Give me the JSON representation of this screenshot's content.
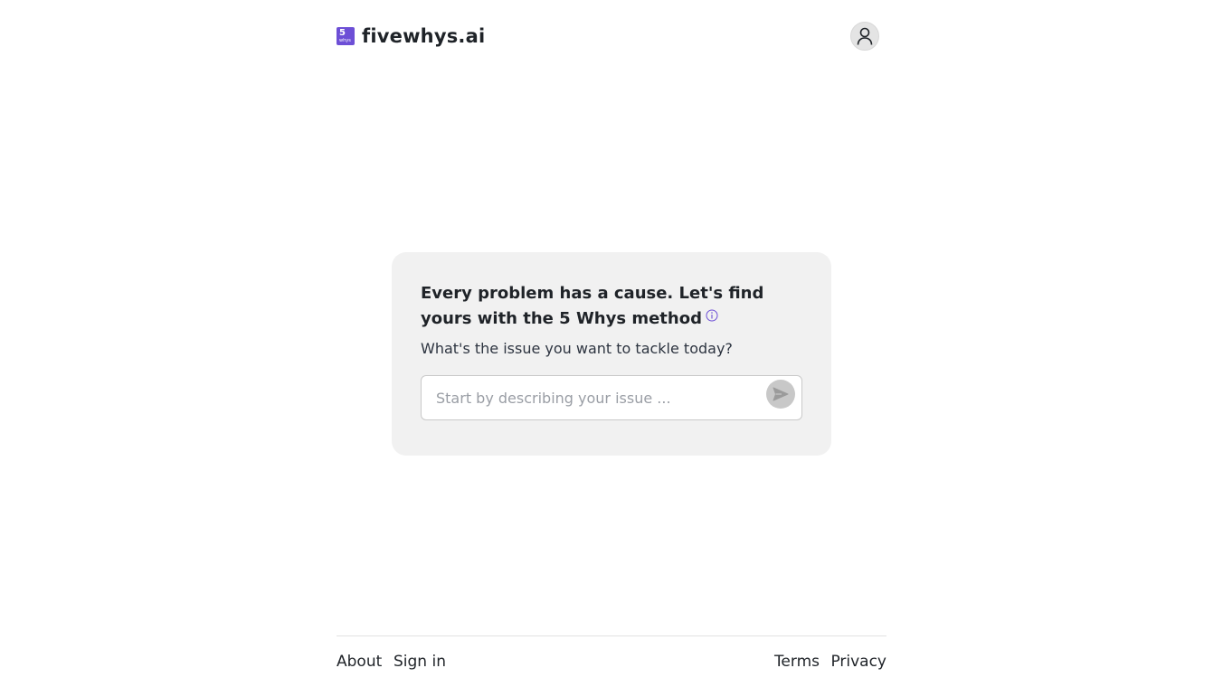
{
  "header": {
    "logo": {
      "badge_number": "5",
      "badge_text": "whys",
      "brand_color": "#6d4fd6",
      "icon": "fivewhys-logo-icon"
    },
    "brand_name": "fivewhys.ai",
    "account_icon": "user-icon"
  },
  "main": {
    "headline": "Every problem has a cause. Let's find yours with the 5 Whys method",
    "info_icon": "info-icon",
    "subhead": "What's the issue you want to tackle today?",
    "input": {
      "value": "",
      "placeholder": "Start by describing your issue ..."
    },
    "send_icon": "send-icon"
  },
  "footer": {
    "left_links": [
      "About",
      "Sign in"
    ],
    "right_links": [
      "Terms",
      "Privacy"
    ]
  },
  "colors": {
    "accent": "#6d4fd6",
    "card_background": "#f1f1f1",
    "send_button_disabled": "#c8c8c8"
  }
}
